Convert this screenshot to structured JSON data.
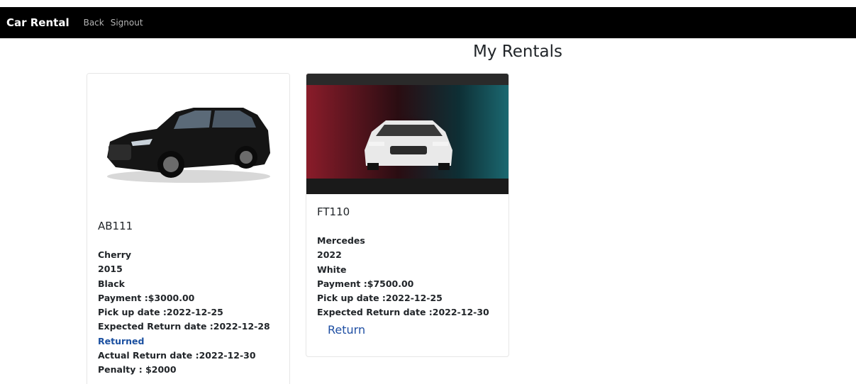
{
  "navbar": {
    "brand": "Car Rental",
    "links": [
      "Back",
      "Signout"
    ]
  },
  "page": {
    "title": "My Rentals"
  },
  "rentals": [
    {
      "plate": "AB111",
      "make": "Cherry",
      "year": "2015",
      "color": "Black",
      "payment": "Payment :$3000.00",
      "pickup": "Pick up date :2022-12-25",
      "expected_return": "Expected Return date :2022-12-28",
      "status": "Returned",
      "actual_return": "Actual Return date :2022-12-30",
      "penalty": "Penalty : $2000",
      "image_icon": "black-suv-photo"
    },
    {
      "plate": "FT110",
      "make": "Mercedes",
      "year": "2022",
      "color": "White",
      "payment": "Payment :$7500.00",
      "pickup": "Pick up date :2022-12-25",
      "expected_return": "Expected Return date :2022-12-30",
      "action_label": "Return",
      "image_icon": "white-car-garage-photo"
    }
  ],
  "colors": {
    "navbar_bg": "#000000",
    "link_blue": "#1f4fa3"
  }
}
